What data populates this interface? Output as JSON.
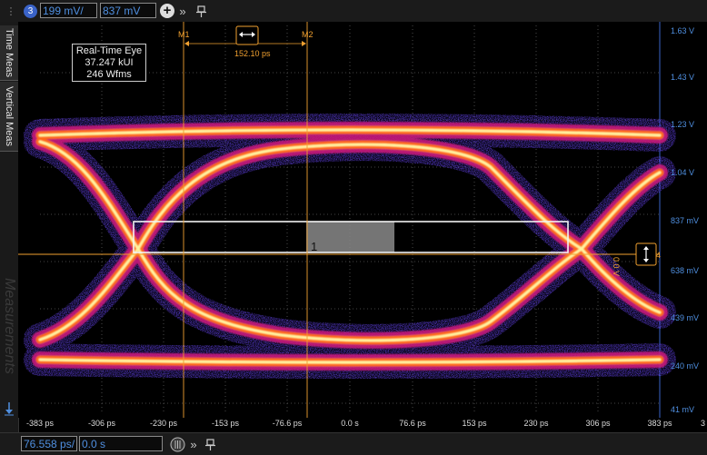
{
  "top_toolbar": {
    "channel_number": "3",
    "scale_value": "199 mV/",
    "offset_value": "837 mV"
  },
  "side_tabs": {
    "time_meas": "Time Meas",
    "vertical_meas": "Vertical Meas",
    "measurements_watermark": "Measurements"
  },
  "eye_info": {
    "title": "Real-Time Eye",
    "kui": "37.247 kUI",
    "wfms": "246 Wfms"
  },
  "markers": {
    "m1_label": "M1",
    "m2_label": "M2",
    "delta_label": "152.10 ps",
    "mask_index": "1",
    "level_label": "0.0 V",
    "ch_ref": "4"
  },
  "axes": {
    "y_labels": [
      "1.63 V",
      "1.43 V",
      "1.23 V",
      "1.04 V",
      "837 mV",
      "638 mV",
      "439 mV",
      "240 mV",
      "41 mV"
    ],
    "x_labels": [
      "-383 ps",
      "-306 ps",
      "-230 ps",
      "-153 ps",
      "-76.6 ps",
      "0.0 s",
      "76.6 ps",
      "153 ps",
      "230 ps",
      "306 ps",
      "383 ps"
    ],
    "x_edge_label": "3"
  },
  "bottom_toolbar": {
    "time_scale": "76.558 ps/",
    "time_offset": "0.0 s"
  },
  "colors": {
    "trace_hot": "#fff4a0",
    "trace_mid": "#ff7a1a",
    "trace_cool": "#d0206a",
    "trace_sparse": "#6040d0",
    "marker": "#f0a030",
    "axis_label": "#4f8fe0"
  },
  "icons": {
    "channel_badge": "channel-badge-icon",
    "add": "plus-icon",
    "expand": "double-chevron-icon",
    "pin": "pin-icon",
    "trigger_arrow": "arrow-down-icon",
    "marker_handle": "marker-handle-icon",
    "horizontal_knob": "knob-icon"
  }
}
